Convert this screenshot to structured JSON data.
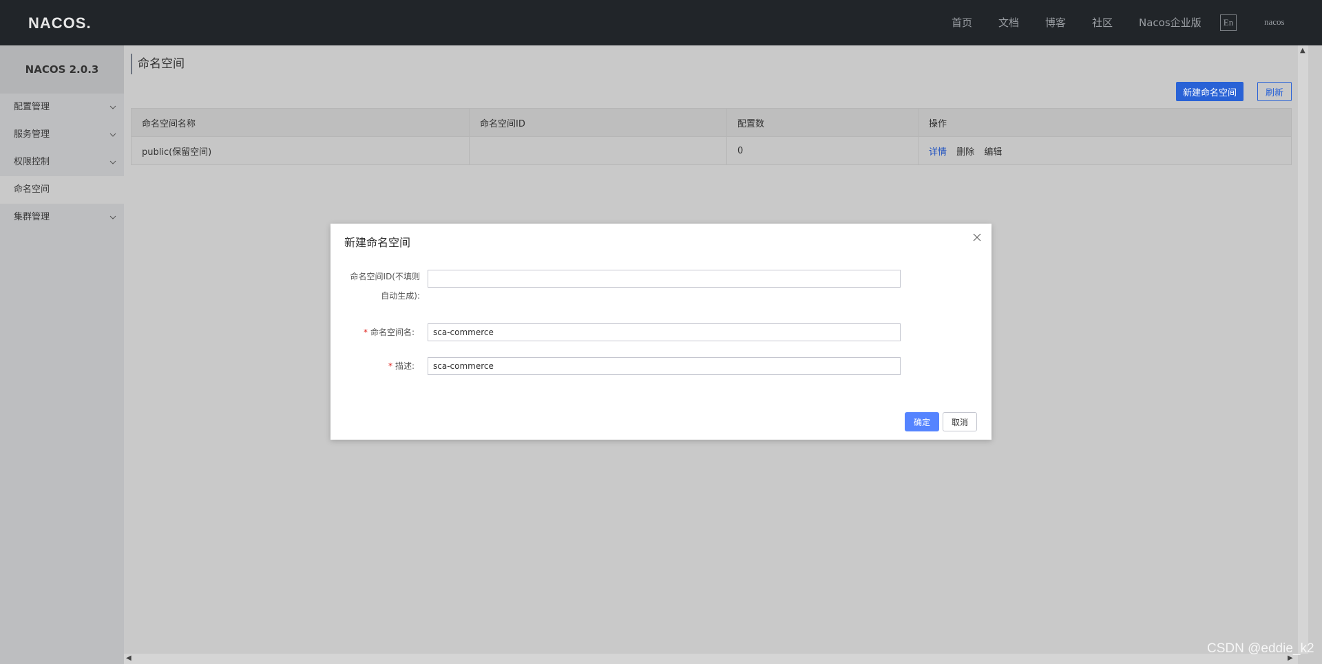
{
  "brand": {
    "logo_text": "NACOS."
  },
  "topnav": {
    "links": [
      "首页",
      "文档",
      "博客",
      "社区",
      "Nacos企业版"
    ],
    "lang": "En",
    "user": "nacos"
  },
  "sidebar": {
    "version": "NACOS 2.0.3",
    "items": [
      {
        "label": "配置管理",
        "has_children": true
      },
      {
        "label": "服务管理",
        "has_children": true
      },
      {
        "label": "权限控制",
        "has_children": true
      },
      {
        "label": "命名空间",
        "has_children": false,
        "active": true
      },
      {
        "label": "集群管理",
        "has_children": true
      }
    ]
  },
  "page": {
    "title": "命名空间",
    "new_button": "新建命名空间",
    "refresh_button": "刷新"
  },
  "table": {
    "headers": [
      "命名空间名称",
      "命名空间ID",
      "配置数",
      "操作"
    ],
    "rows": [
      {
        "name": "public(保留空间)",
        "id": "",
        "count": "0",
        "actions": [
          "详情",
          "删除",
          "编辑"
        ]
      }
    ]
  },
  "dialog": {
    "title": "新建命名空间",
    "id_label_line1": "命名空间ID(不填则",
    "id_label_line2": "自动生成):",
    "id_value": "",
    "name_label": "命名空间名:",
    "name_value": "sca-commerce",
    "desc_label": "描述:",
    "desc_value": "sca-commerce",
    "required_mark": "*",
    "ok": "确定",
    "cancel": "取消"
  },
  "watermark": "CSDN @eddie_k2",
  "colors": {
    "topbar": "#212529",
    "primary": "#2962d6",
    "dialog_ok": "#5584ff"
  }
}
